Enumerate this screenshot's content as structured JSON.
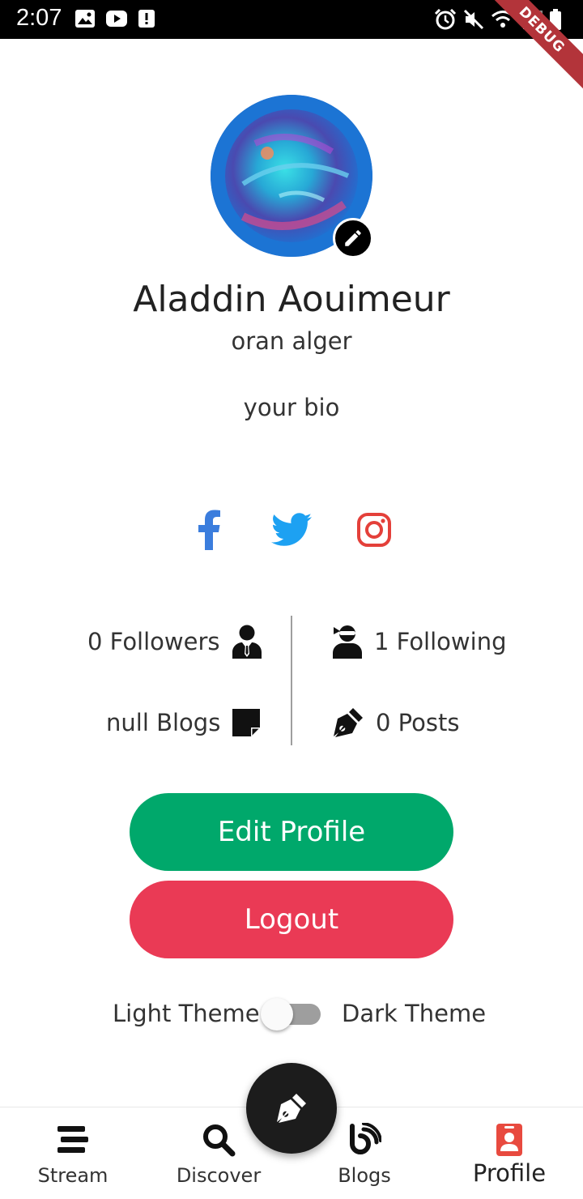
{
  "status_bar": {
    "time": "2:07",
    "debug_label": "DEBUG"
  },
  "profile": {
    "name": "Aladdin Aouimeur",
    "location": "oran alger",
    "bio": "your bio"
  },
  "stats": {
    "followers": "0 Followers",
    "following": "1 Following",
    "blogs": "null Blogs",
    "posts": "0 Posts"
  },
  "buttons": {
    "edit_profile": "Edit Profile",
    "logout": "Logout"
  },
  "theme": {
    "light_label": "Light Theme",
    "dark_label": "Dark Theme",
    "dark_enabled": false
  },
  "nav": {
    "items": [
      {
        "label": "Stream",
        "icon": "stream-icon"
      },
      {
        "label": "Discover",
        "icon": "search-icon"
      },
      {
        "label": "Blogs",
        "icon": "blogger-icon"
      },
      {
        "label": "Profile",
        "icon": "profile-badge-icon",
        "active": true
      }
    ]
  },
  "colors": {
    "facebook": "#3b7ddd",
    "twitter": "#1da1f2",
    "instagram": "#e4403a",
    "edit_button": "#00a86b",
    "logout_button": "#ea3a55",
    "active_nav": "#e84a3f"
  }
}
